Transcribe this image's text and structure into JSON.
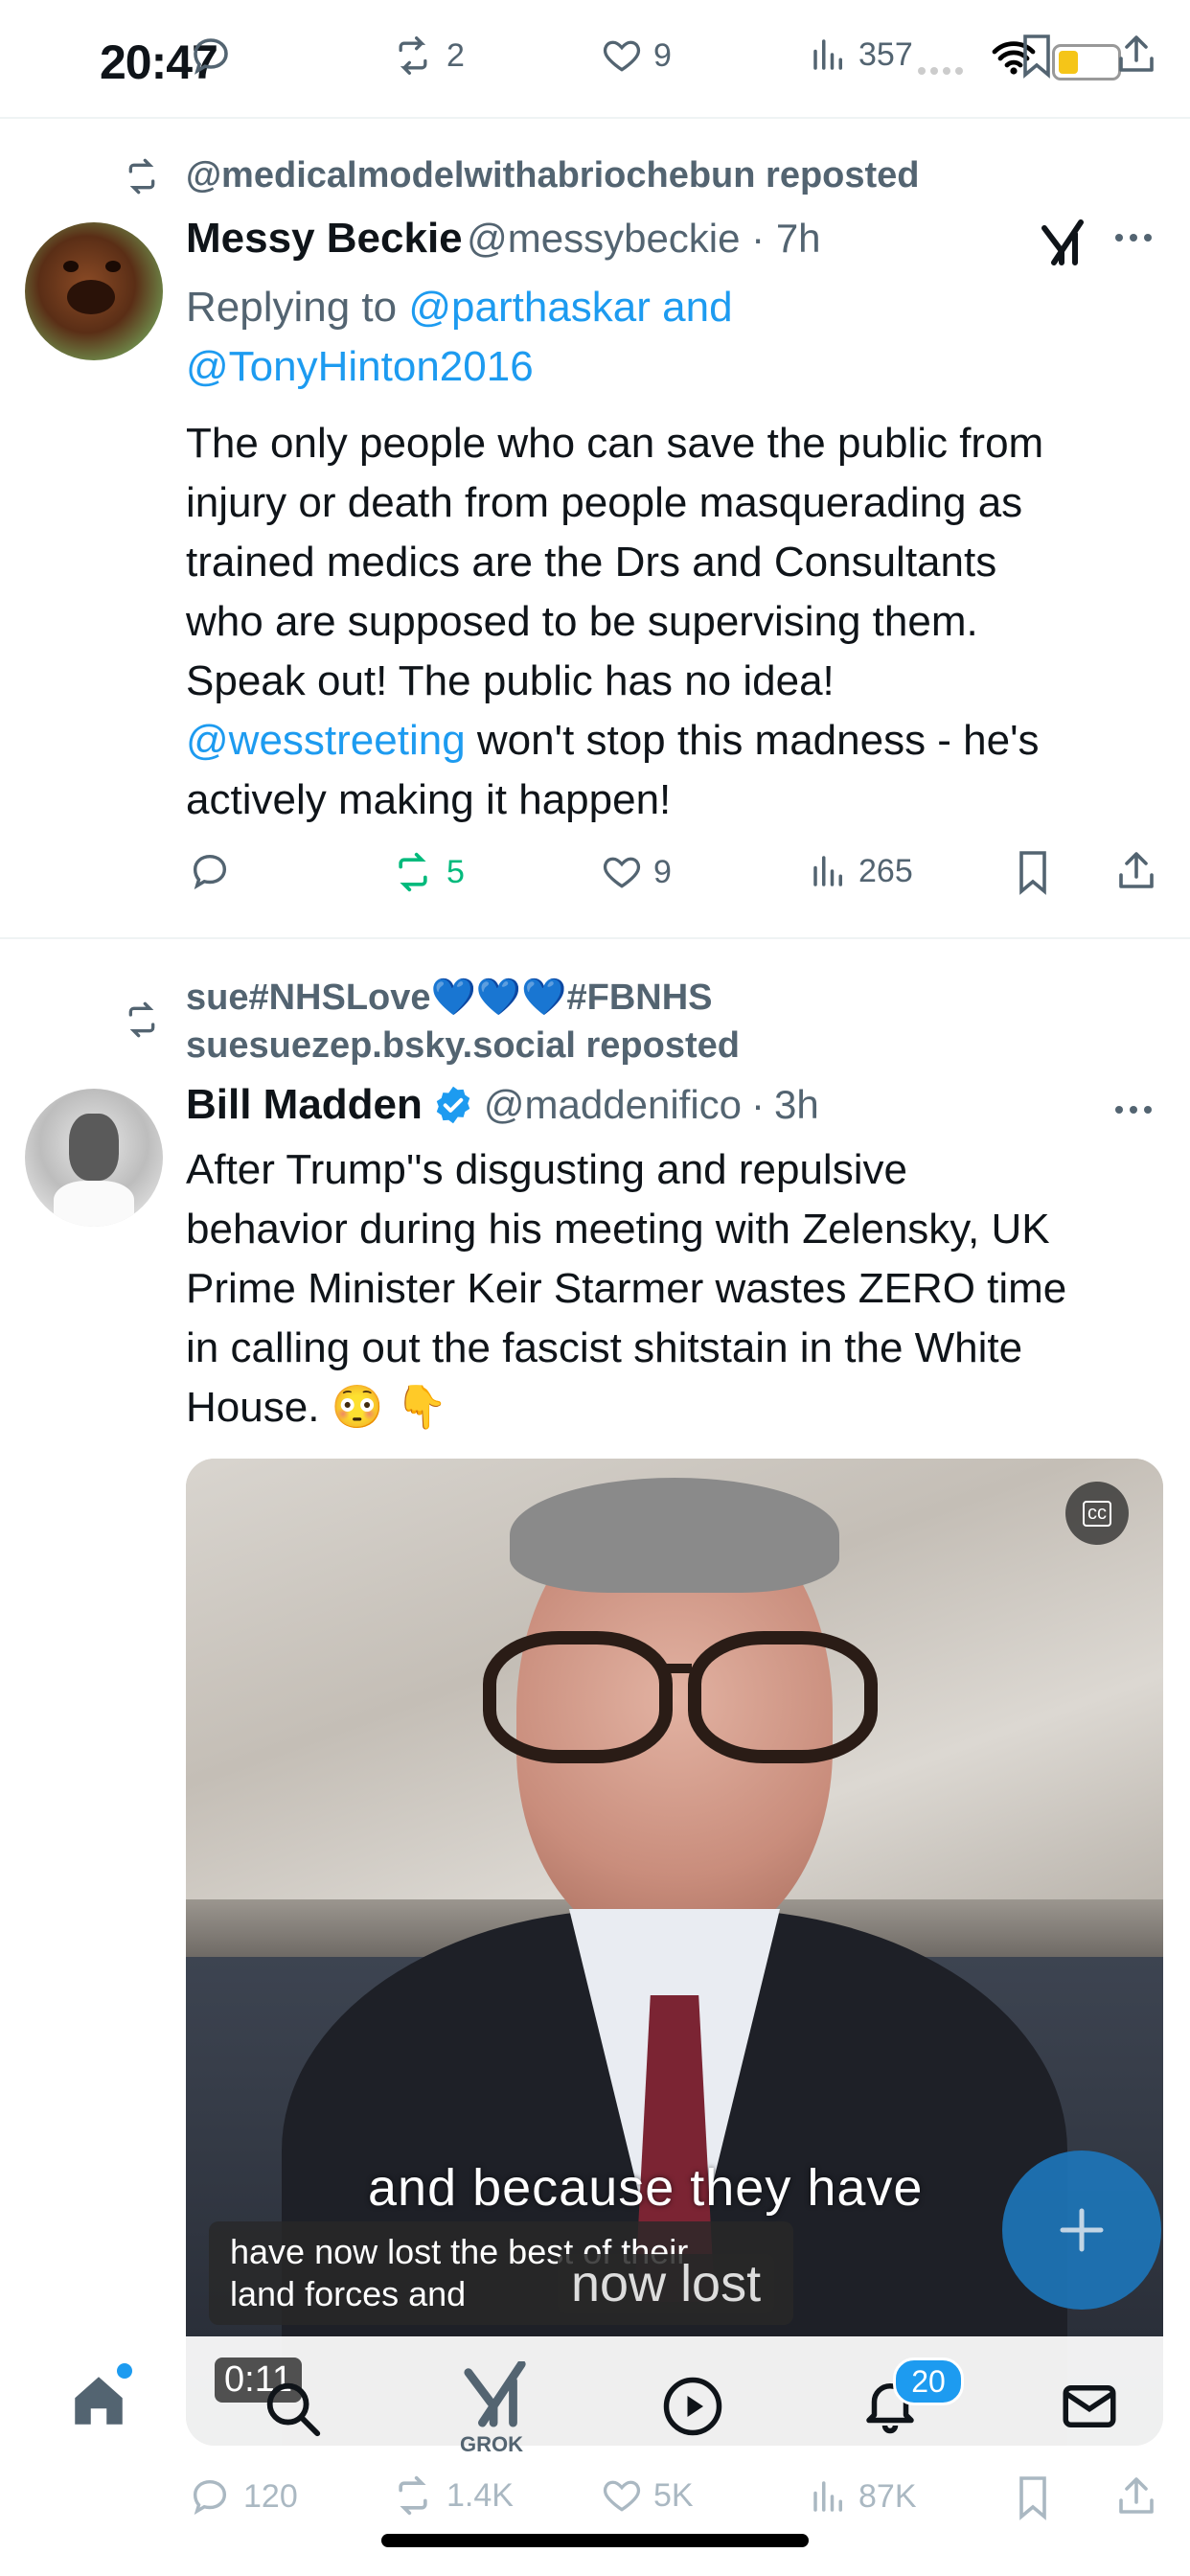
{
  "status_bar": {
    "time": "20:47"
  },
  "top_actions": {
    "retweets": "2",
    "likes": "9",
    "views": "357"
  },
  "tweet1": {
    "repost_text": "@medicalmodelwithabriochebun reposted",
    "name": "Messy Beckie",
    "handle": "@messybeckie",
    "time": "7h",
    "replying_label": "Replying to",
    "replying_users": "@parthaskar and",
    "replying_users2": "@TonyHinton2016",
    "body_lines": [
      "The only people who can save the public from",
      "injury or death from people masquerading as",
      "trained medics are the Drs and Consultants",
      "who are supposed to be supervising them.",
      "Speak out! The public has no idea!"
    ],
    "mention": "@wesstreeting",
    "body_after_mention": " won't stop this madness - he's",
    "body_last": "actively making it happen!",
    "retweets": "5",
    "likes": "9",
    "views": "265",
    "accent": "#00ba7c"
  },
  "tweet2": {
    "repost_line1": "sue#NHSLove💙💙💙#FBNHS",
    "repost_line2": "suesuezep.bsky.social reposted",
    "name": "Bill Madden",
    "handle": "@maddenifico",
    "time": "3h",
    "body_lines": [
      "After Trump''s disgusting and repulsive",
      "behavior during his meeting with Zelensky, UK",
      "Prime Minister Keir Starmer wastes ZERO time",
      "in calling out the fascist shitstain in the White",
      "House. 😳 👇"
    ],
    "video": {
      "caption_main": "and because they have",
      "caption_box_line1": "have now lost the best of their",
      "caption_box_line2": "land forces and",
      "caption_now_lost": "now lost",
      "timestamp": "0:11",
      "cc_label": "cc"
    },
    "replies": "120",
    "retweets": "1.4K",
    "likes": "5K",
    "views": "87K"
  },
  "bottom_nav": {
    "grok_label": "GROK",
    "notifications_count": "20"
  },
  "colors": {
    "link": "#1d9bf0",
    "muted": "#536471",
    "verified": "#1d9bf0",
    "fab": "#1d75b8"
  }
}
